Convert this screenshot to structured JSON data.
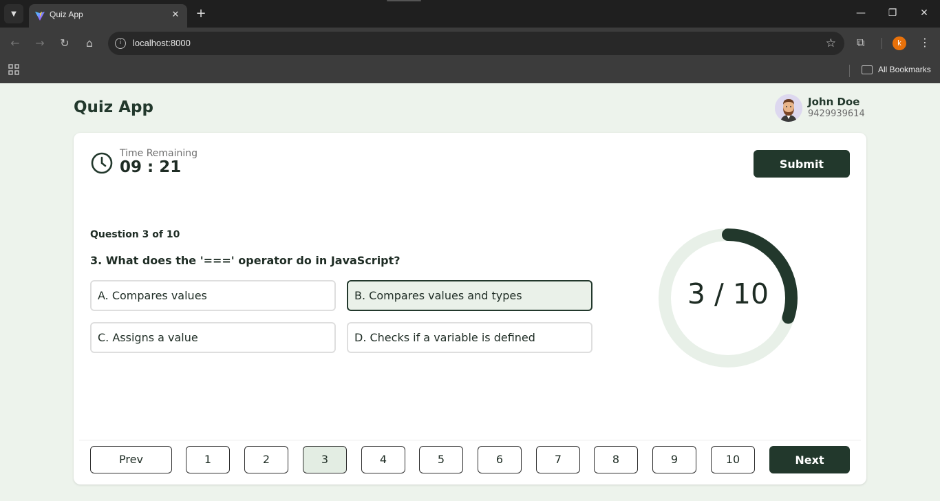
{
  "browser": {
    "tab_title": "Quiz App",
    "url": "localhost:8000",
    "bookmarks_label": "All Bookmarks",
    "profile_initial": "k"
  },
  "app": {
    "title": "Quiz App",
    "user": {
      "name": "John Doe",
      "phone": "9429939614"
    }
  },
  "timer": {
    "label": "Time Remaining",
    "value": "09 : 21"
  },
  "submit_label": "Submit",
  "question": {
    "counter": "Question 3 of 10",
    "text": "3. What does the '===' operator do in JavaScript?",
    "options": [
      {
        "label": "A. Compares values",
        "selected": false
      },
      {
        "label": "B. Compares values and types",
        "selected": true
      },
      {
        "label": "C. Assigns a value",
        "selected": false
      },
      {
        "label": "D. Checks if a variable is defined",
        "selected": false
      }
    ]
  },
  "progress": {
    "current": 3,
    "total": 10,
    "label": "3 / 10"
  },
  "pagination": {
    "prev_label": "Prev",
    "next_label": "Next",
    "pages": [
      "1",
      "2",
      "3",
      "4",
      "5",
      "6",
      "7",
      "8",
      "9",
      "10"
    ],
    "current_page": "3"
  },
  "colors": {
    "primary": "#22382c",
    "background": "#edf3ec",
    "selected_option_bg": "#eaf1e9",
    "progress_track": "#e8f0e8"
  }
}
